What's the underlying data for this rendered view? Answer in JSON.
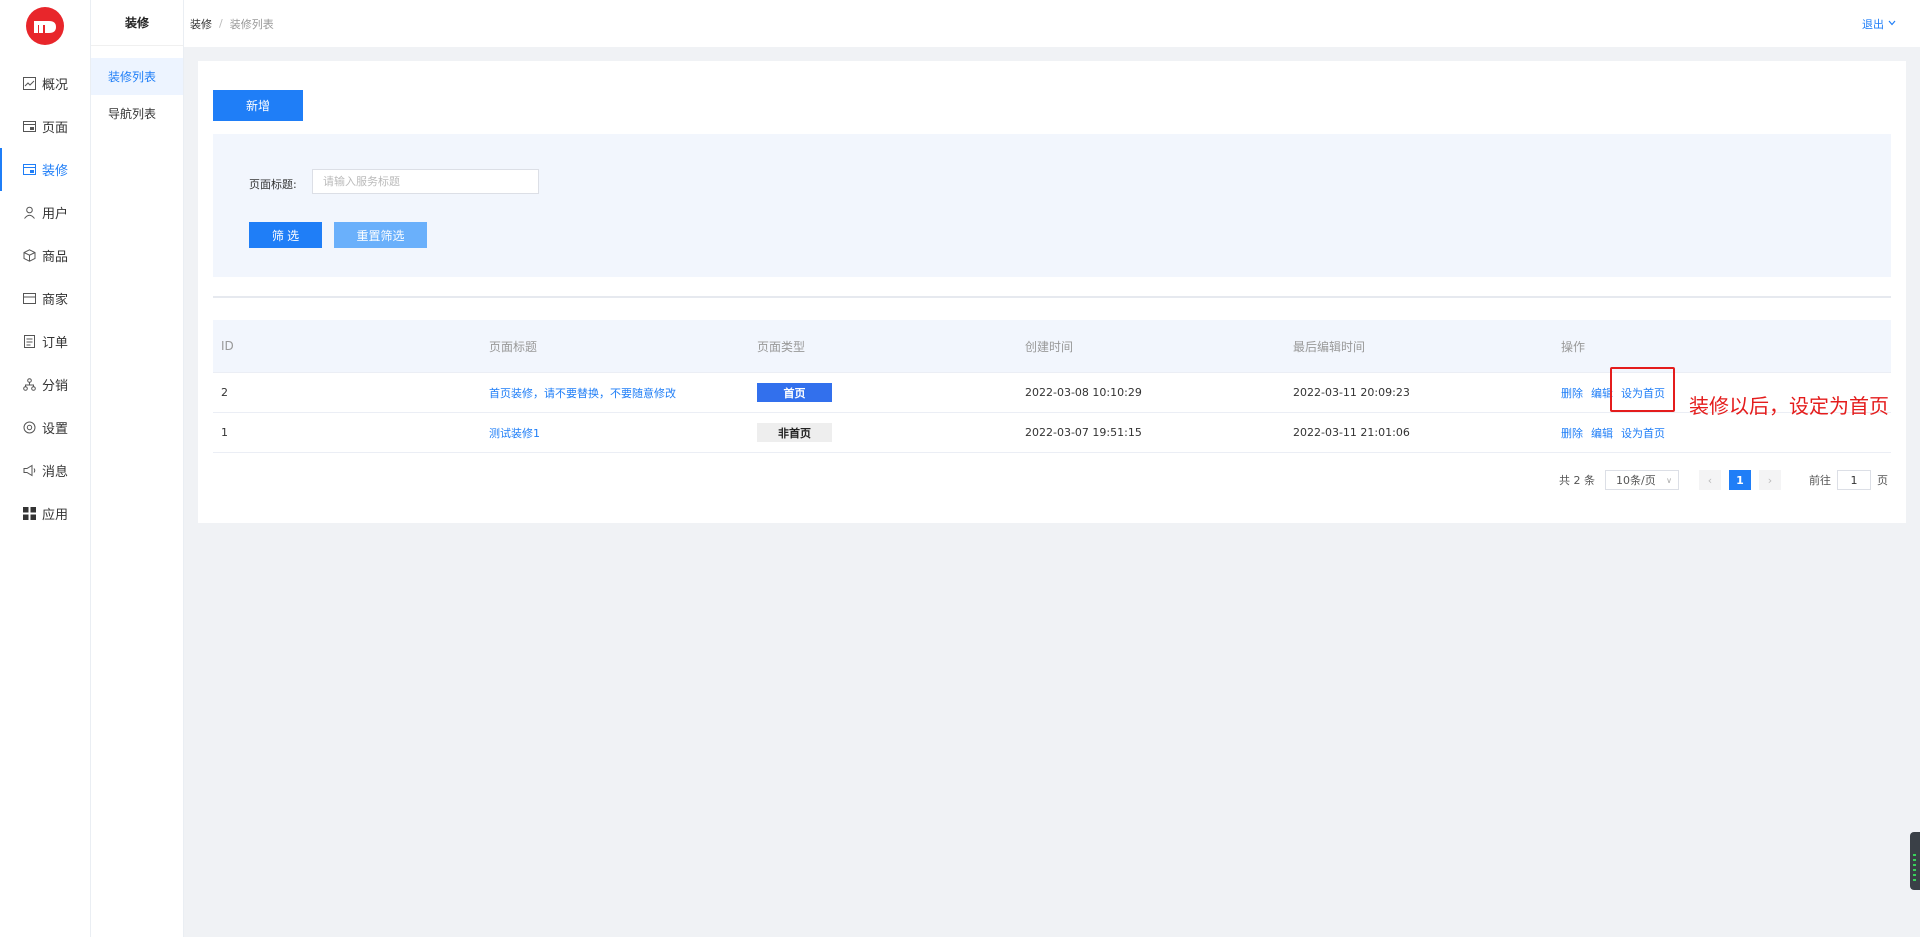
{
  "brand": {
    "logo_color": "#e8262b",
    "accent": "#1f7ef7"
  },
  "nav": {
    "items": [
      {
        "label": "概况",
        "icon": "chart-icon",
        "active": false
      },
      {
        "label": "页面",
        "icon": "page-icon",
        "active": false
      },
      {
        "label": "装修",
        "icon": "decoration-icon",
        "active": true
      },
      {
        "label": "用户",
        "icon": "user-icon",
        "active": false
      },
      {
        "label": "商品",
        "icon": "box-icon",
        "active": false
      },
      {
        "label": "商家",
        "icon": "store-icon",
        "active": false
      },
      {
        "label": "订单",
        "icon": "order-icon",
        "active": false
      },
      {
        "label": "分销",
        "icon": "distribution-icon",
        "active": false
      },
      {
        "label": "设置",
        "icon": "settings-icon",
        "active": false
      },
      {
        "label": "消息",
        "icon": "megaphone-icon",
        "active": false
      },
      {
        "label": "应用",
        "icon": "grid-icon",
        "active": false
      }
    ]
  },
  "subnav": {
    "title": "装修",
    "items": [
      {
        "label": "装修列表",
        "active": true
      },
      {
        "label": "导航列表",
        "active": false
      }
    ]
  },
  "breadcrumb": {
    "root": "装修",
    "sep": "/",
    "current": "装修列表"
  },
  "topbar": {
    "logout": "退出"
  },
  "toolbar": {
    "new_label": "新增"
  },
  "filter": {
    "label": "页面标题:",
    "placeholder": "请输入服务标题",
    "value": "",
    "filter_label": "筛 选",
    "reset_label": "重置筛选"
  },
  "table": {
    "columns": [
      "ID",
      "页面标题",
      "页面类型",
      "创建时间",
      "最后编辑时间",
      "操作"
    ],
    "rows": [
      {
        "id": "2",
        "title": "首页装修，请不要替换，不要随意修改",
        "type": "首页",
        "created": "2022-03-08 10:10:29",
        "edited": "2022-03-11 20:09:23"
      },
      {
        "id": "1",
        "title": "测试装修1",
        "type": "非首页",
        "created": "2022-03-07 19:51:15",
        "edited": "2022-03-11 21:01:06"
      }
    ],
    "actions": {
      "delete": "删除",
      "edit": "编辑",
      "set_home": "设为首页"
    }
  },
  "annotation": {
    "text": "装修以后，设定为首页",
    "color": "#e41c1c"
  },
  "pagination": {
    "total": "共 2 条",
    "page_size": "10条/页",
    "current_page": "1",
    "goto_prefix": "前往",
    "goto_value": "1",
    "goto_suffix": "页"
  }
}
